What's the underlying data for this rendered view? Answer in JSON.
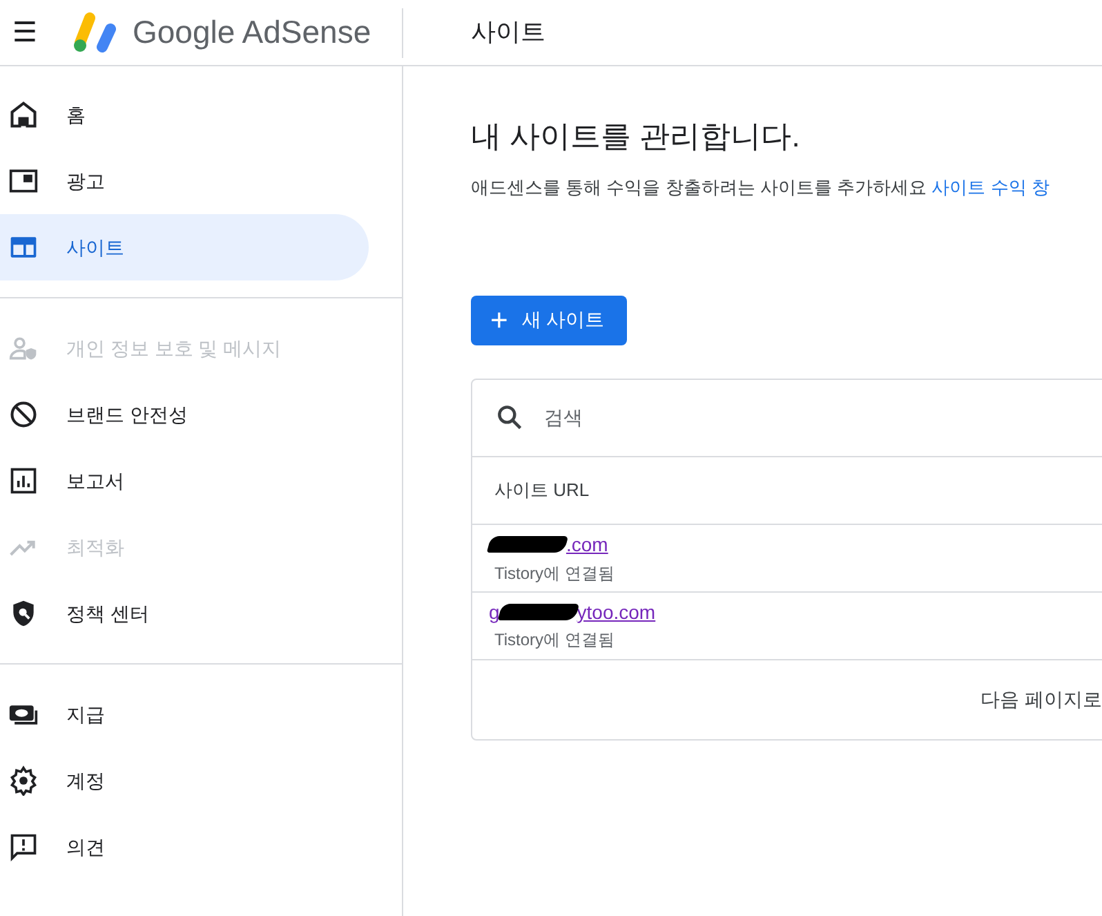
{
  "header": {
    "menu_icon": "☰",
    "brand": "Google AdSense",
    "page_title": "사이트"
  },
  "sidebar": {
    "groups": [
      [
        {
          "kind": "home",
          "label": "홈",
          "selected": false,
          "disabled": false
        },
        {
          "kind": "ads",
          "label": "광고",
          "selected": false,
          "disabled": false
        },
        {
          "kind": "sites",
          "label": "사이트",
          "selected": true,
          "disabled": false
        }
      ],
      [
        {
          "kind": "privacy",
          "label": "개인 정보 보호 및 메시지",
          "selected": false,
          "disabled": true
        },
        {
          "kind": "block",
          "label": "브랜드 안전성",
          "selected": false,
          "disabled": false
        },
        {
          "kind": "report",
          "label": "보고서",
          "selected": false,
          "disabled": false
        },
        {
          "kind": "trend",
          "label": "최적화",
          "selected": false,
          "disabled": true
        },
        {
          "kind": "policy",
          "label": "정책 센터",
          "selected": false,
          "disabled": false
        }
      ],
      [
        {
          "kind": "payment",
          "label": "지급",
          "selected": false,
          "disabled": false
        },
        {
          "kind": "settings",
          "label": "계정",
          "selected": false,
          "disabled": false
        },
        {
          "kind": "feedback",
          "label": "의견",
          "selected": false,
          "disabled": false
        }
      ]
    ]
  },
  "main": {
    "heading": "내 사이트를 관리합니다.",
    "description": "애드센스를 통해 수익을 창출하려는 사이트를 추가하세요",
    "description_link": "사이트 수익 창",
    "new_site_button": {
      "icon": "+",
      "label": "새 사이트"
    },
    "table": {
      "search": {
        "placeholder": "검색"
      },
      "columns": [
        "사이트 URL"
      ],
      "rows": [
        {
          "url_start": "",
          "url_end": ".com",
          "status": "Tistory에 연결됨"
        },
        {
          "url_start": "g",
          "url_end": "ytoo.com",
          "status": "Tistory에 연결됨"
        }
      ],
      "next_page": "다음 페이지로"
    }
  }
}
